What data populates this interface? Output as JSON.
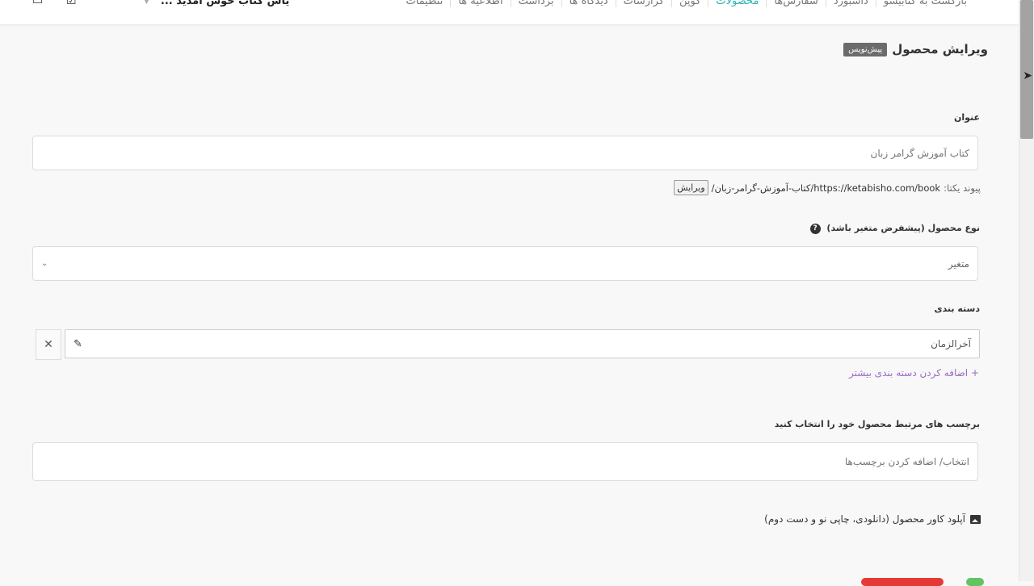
{
  "nav": {
    "items": [
      {
        "label": "بازگشت به کتابیشو",
        "active": false
      },
      {
        "label": "داشبورد",
        "active": false
      },
      {
        "label": "سفارش‌ها",
        "active": false
      },
      {
        "label": "محصولات",
        "active": true
      },
      {
        "label": "کوپن",
        "active": false
      },
      {
        "label": "گزارشات",
        "active": false
      },
      {
        "label": "دیدگاه ها",
        "active": false
      },
      {
        "label": "برداشت",
        "active": false
      },
      {
        "label": "اطلاعیه ها",
        "active": false
      },
      {
        "label": "تنظیمات",
        "active": false
      }
    ],
    "store_name": "یاس کتاب خوش امدید ...",
    "active_color": "#2bb4b2"
  },
  "page": {
    "title": "ویرایش محصول",
    "status_badge": "پیش‌نویس"
  },
  "form": {
    "title_label": "عنوان",
    "title_value": "کتاب آموزش گرامر زبان",
    "permalink_label": "پیوند یکتا:",
    "permalink_url": "https://ketabisho.com/book/کتاب-آموزش-گرامر-زبان/",
    "permalink_edit": "ویرایش",
    "type_label": "نوع محصول (پیشفرض متغیر باشد)",
    "type_value": "متغیر",
    "category_label": "دسته بندی",
    "category_value": "آخرالزمان",
    "add_category": "+ اضافه کردن دسته بندی بیشتر",
    "tags_label": "برچسب های مرتبط محصول خود را انتخاب کنید",
    "tags_placeholder": "انتخاب/ اضافه کردن برچسب‌ها",
    "upload_label": "آپلود کاور محصول (دانلودی، چاپی نو و دست دوم)"
  },
  "icons": {
    "help": "question-circle-icon",
    "edit": "pencil-edit-icon",
    "remove": "close-icon",
    "image": "image-icon",
    "dropdown": "chevron-down-icon"
  }
}
